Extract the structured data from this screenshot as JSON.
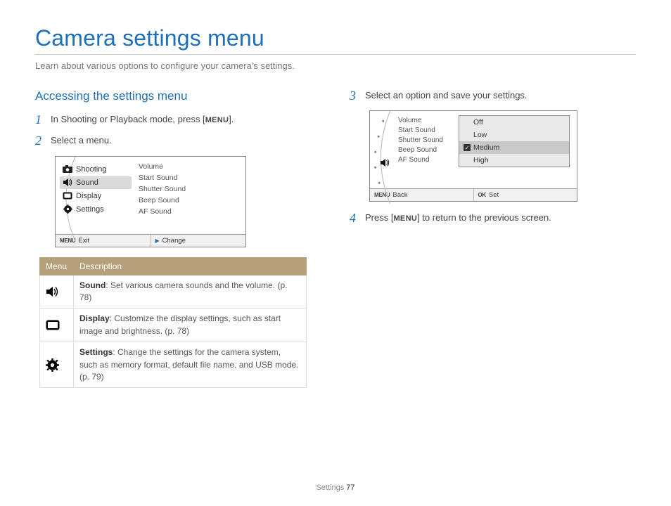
{
  "page": {
    "title": "Camera settings menu",
    "subtitle": "Learn about various options to configure your camera's settings.",
    "footer_section": "Settings",
    "footer_page": "77"
  },
  "left": {
    "heading": "Accessing the settings menu",
    "step1_a": "In Shooting or Playback mode, press [",
    "step1_btn": "MENU",
    "step1_b": "].",
    "step2": "Select a menu.",
    "cam": {
      "items": [
        {
          "label": "Shooting"
        },
        {
          "label": "Sound"
        },
        {
          "label": "Display"
        },
        {
          "label": "Settings"
        }
      ],
      "right_list": [
        "Volume",
        "Start Sound",
        "Shutter Sound",
        "Beep Sound",
        "AF Sound"
      ],
      "footer_left_icon": "MENU",
      "footer_left": "Exit",
      "footer_right": "Change"
    },
    "table": {
      "h1": "Menu",
      "h2": "Description",
      "rows": [
        {
          "bold": "Sound",
          "rest": ": Set various camera sounds and the volume. (p. 78)"
        },
        {
          "bold": "Display",
          "rest": ": Customize the display settings, such as start image and brightness. (p. 78)"
        },
        {
          "bold": "Settings",
          "rest": ": Change the settings for the camera system, such as memory format, default file name, and USB mode. (p. 79)"
        }
      ]
    }
  },
  "right": {
    "step3": "Select an option and save your settings.",
    "cam": {
      "left_list": [
        "Volume",
        "Start Sound",
        "Shutter Sound",
        "Beep Sound",
        "AF Sound"
      ],
      "options": [
        "Off",
        "Low",
        "Medium",
        "High"
      ],
      "footer_left_icon": "MENU",
      "footer_left": "Back",
      "footer_right_icon": "OK",
      "footer_right": "Set"
    },
    "step4_a": "Press [",
    "step4_btn": "MENU",
    "step4_b": "] to return to the previous screen."
  },
  "nums": {
    "n1": "1",
    "n2": "2",
    "n3": "3",
    "n4": "4"
  }
}
